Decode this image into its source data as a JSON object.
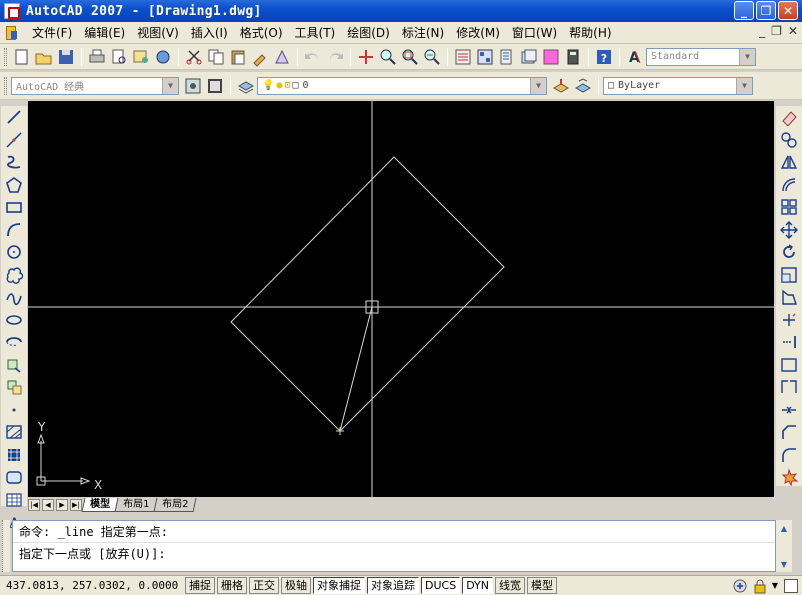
{
  "window": {
    "title": "AutoCAD 2007 - [Drawing1.dwg]",
    "controls": [
      "_",
      "❐",
      "✕"
    ]
  },
  "menu": {
    "items": [
      "文件(F)",
      "编辑(E)",
      "视图(V)",
      "插入(I)",
      "格式(O)",
      "工具(T)",
      "绘图(D)",
      "标注(N)",
      "修改(M)",
      "窗口(W)",
      "帮助(H)"
    ],
    "mdi": [
      "_",
      "❐",
      "✕"
    ]
  },
  "toolbar": {
    "text_style": "Standard",
    "workspace": "AutoCAD 经典",
    "layer": "0",
    "color": "ByLayer"
  },
  "ucs": {
    "x_label": "X",
    "y_label": "Y"
  },
  "tabs": {
    "nav": [
      "|◀",
      "◀",
      "▶",
      "▶|"
    ],
    "items": [
      "模型",
      "布局1",
      "布局2"
    ],
    "active": "模型"
  },
  "command": {
    "line1": "命令: _line 指定第一点:",
    "line2": "指定下一点或 [放弃(U)]:"
  },
  "status": {
    "coords": "437.0813, 257.0302, 0.0000",
    "buttons": [
      "捕捉",
      "栅格",
      "正交",
      "极轴",
      "对象捕捉",
      "对象追踪",
      "DUCS",
      "DYN",
      "线宽",
      "模型"
    ]
  },
  "colors": {
    "canvas_bg": "#000000",
    "drawing_lines": "#d8d8d8",
    "titlebar": "#0a4fcc"
  },
  "icons": {
    "draw_palette": [
      "line-icon",
      "construction-line-icon",
      "polyline-icon",
      "polygon-icon",
      "rectangle-icon",
      "arc-icon",
      "circle-icon",
      "revision-cloud-icon",
      "spline-icon",
      "ellipse-icon",
      "ellipse-arc-icon",
      "insert-block-icon",
      "make-block-icon",
      "point-icon",
      "hatch-icon",
      "gradient-icon",
      "region-icon",
      "table-icon",
      "multiline-text-icon"
    ],
    "modify_palette": [
      "erase-icon",
      "copy-icon",
      "mirror-icon",
      "offset-icon",
      "array-icon",
      "move-icon",
      "rotate-icon",
      "scale-icon",
      "stretch-icon",
      "trim-icon",
      "extend-icon",
      "break-at-point-icon",
      "break-icon",
      "join-icon",
      "chamfer-icon",
      "fillet-icon",
      "explode-icon"
    ]
  }
}
